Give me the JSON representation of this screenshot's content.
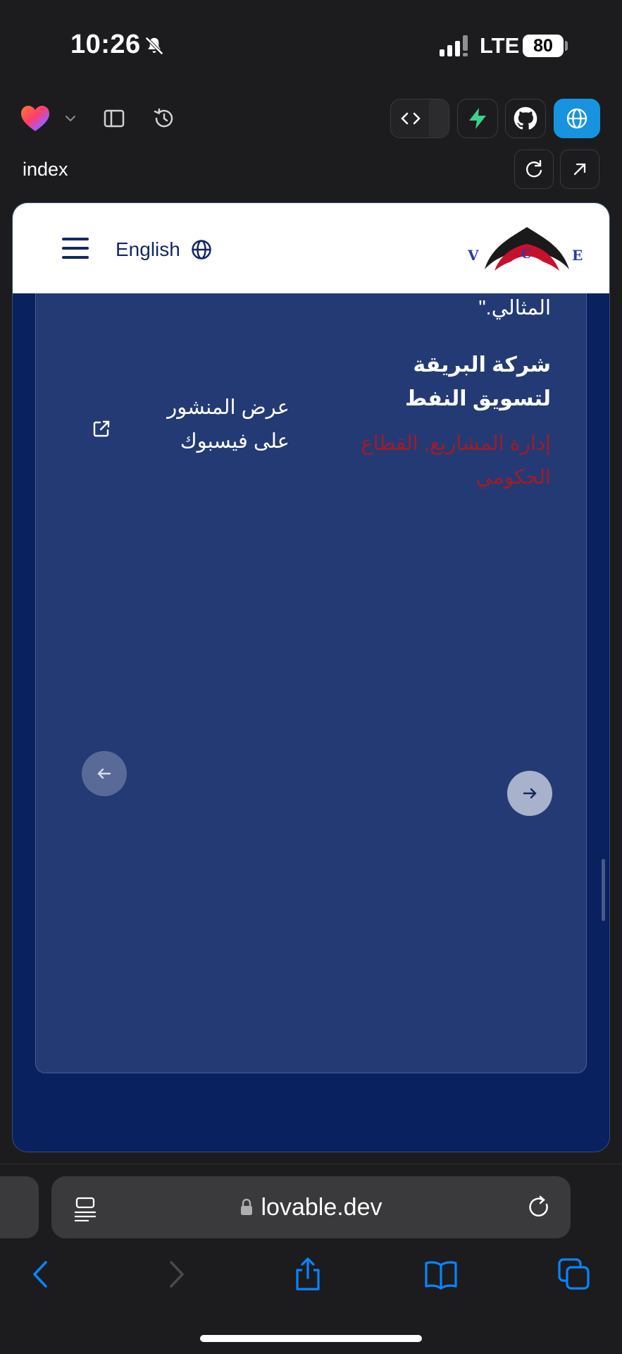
{
  "status_bar": {
    "time": "10:26",
    "network": "LTE",
    "battery": "80"
  },
  "toolbar": {
    "tab_label": "index",
    "accent_color": "#1893e0"
  },
  "site": {
    "language_button": "English",
    "logo_letters": [
      "V",
      "C",
      "E"
    ],
    "testimonial": {
      "quote_tail": "المثالي.\"",
      "company": "شركة البريقة لتسويق النفط",
      "sector": "إدارة المشاريع, القطاع الحكومي",
      "facebook_link": "عرض المنشور على فيسبوك"
    }
  },
  "browser": {
    "url": "lovable.dev"
  }
}
